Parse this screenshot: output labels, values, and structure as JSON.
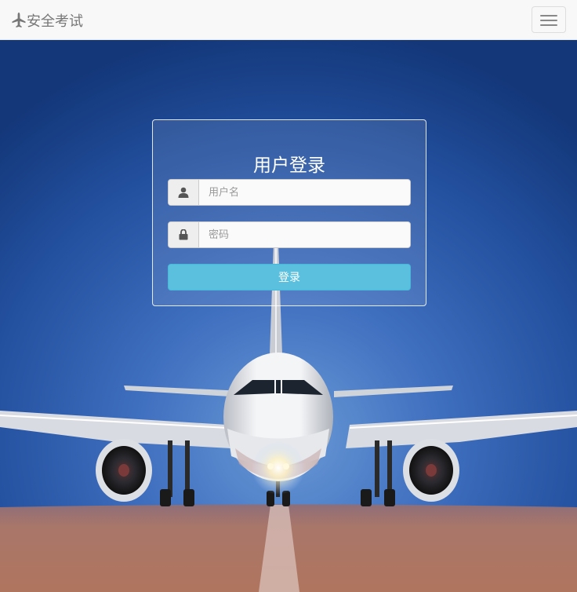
{
  "navbar": {
    "brand_text": "安全考试",
    "brand_icon": "airplane-icon",
    "toggle_icon": "hamburger-menu-icon",
    "background": "#f8f8f8"
  },
  "login": {
    "title": "用户登录",
    "username": {
      "icon": "user-icon",
      "placeholder": "用户名",
      "value": ""
    },
    "password": {
      "icon": "lock-icon",
      "placeholder": "密码",
      "value": ""
    },
    "submit_label": "登录",
    "submit_color": "#5bc0de"
  }
}
